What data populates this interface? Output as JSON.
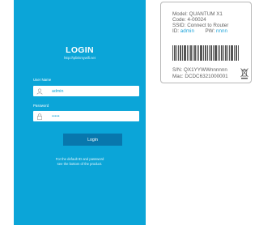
{
  "login": {
    "title": "LOGIN",
    "url": "http://tplinkmywifi.net",
    "username_label": "User Name",
    "username_value": "admin",
    "password_label": "Password",
    "password_value": "•••••",
    "button_label": "Login",
    "hint_line1": "For the default ID and password",
    "hint_line2": "see the bottom of the product."
  },
  "device_label": {
    "model": "Model: QUANTUM X1",
    "code": "Code: 4-00024",
    "ssid": "SSID: Connect to Router",
    "id_prefix": "ID:",
    "id_value": "admin",
    "pw_prefix": "PW:",
    "pw_value": "nnnn",
    "sn": "S/N: QX1YYWWnnnnnn",
    "mac": "Mac: DCDC6321000001"
  },
  "colors": {
    "panel": "#0ba5d8",
    "button": "#0877ad",
    "accent": "#1ea3d9"
  },
  "icons": {
    "user": "user-icon",
    "lock": "lock-icon",
    "weee": "crossed-bin-icon"
  }
}
